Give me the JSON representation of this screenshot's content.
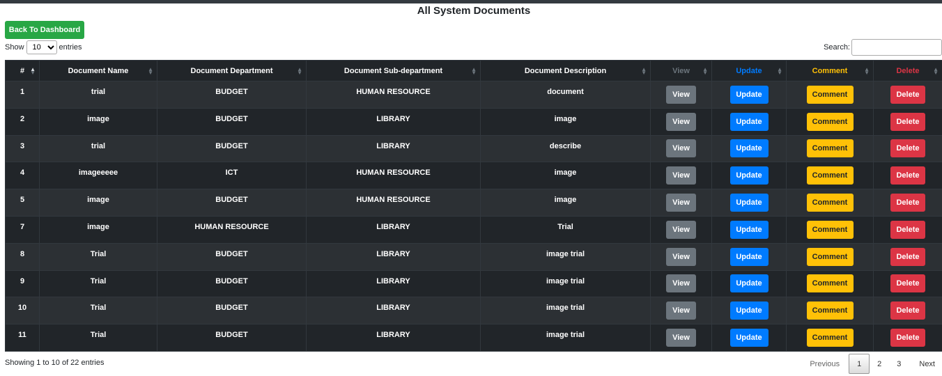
{
  "page_title": "All System Documents",
  "back_button": "Back To Dashboard",
  "length": {
    "show": "Show",
    "value": "10",
    "options": [
      "10"
    ],
    "entries": "entries"
  },
  "search": {
    "label": "Search:",
    "value": ""
  },
  "columns": [
    "#",
    "Document Name",
    "Document Department",
    "Document Sub-department",
    "Document Description",
    "View",
    "Update",
    "Comment",
    "Delete"
  ],
  "rows": [
    {
      "id": "1",
      "name": "trial",
      "department": "BUDGET",
      "subdepartment": "HUMAN RESOURCE",
      "description": "document"
    },
    {
      "id": "2",
      "name": "image",
      "department": "BUDGET",
      "subdepartment": "LIBRARY",
      "description": "image"
    },
    {
      "id": "3",
      "name": "trial",
      "department": "BUDGET",
      "subdepartment": "LIBRARY",
      "description": "describe"
    },
    {
      "id": "4",
      "name": "imageeeee",
      "department": "ICT",
      "subdepartment": "HUMAN RESOURCE",
      "description": "image"
    },
    {
      "id": "5",
      "name": "image",
      "department": "BUDGET",
      "subdepartment": "HUMAN RESOURCE",
      "description": "image"
    },
    {
      "id": "7",
      "name": "image",
      "department": "HUMAN RESOURCE",
      "subdepartment": "LIBRARY",
      "description": "Trial"
    },
    {
      "id": "8",
      "name": "Trial",
      "department": "BUDGET",
      "subdepartment": "LIBRARY",
      "description": "image trial"
    },
    {
      "id": "9",
      "name": "Trial",
      "department": "BUDGET",
      "subdepartment": "LIBRARY",
      "description": "image trial"
    },
    {
      "id": "10",
      "name": "Trial",
      "department": "BUDGET",
      "subdepartment": "LIBRARY",
      "description": "image trial"
    },
    {
      "id": "11",
      "name": "Trial",
      "department": "BUDGET",
      "subdepartment": "LIBRARY",
      "description": "image trial"
    }
  ],
  "buttons": {
    "view": "View",
    "update": "Update",
    "comment": "Comment",
    "delete": "Delete"
  },
  "info": "Showing 1 to 10 of 22 entries",
  "pagination": {
    "previous": "Previous",
    "pages": [
      "1",
      "2",
      "3"
    ],
    "current": "1",
    "next": "Next"
  },
  "icons": {
    "sort": "sort-icon",
    "sort_asc": "sort-ascending-icon"
  },
  "colors": {
    "success": "#28a745",
    "secondary": "#6c757d",
    "primary": "#007bff",
    "warning": "#ffc107",
    "danger": "#dc3545",
    "table_dark": "#212529"
  }
}
